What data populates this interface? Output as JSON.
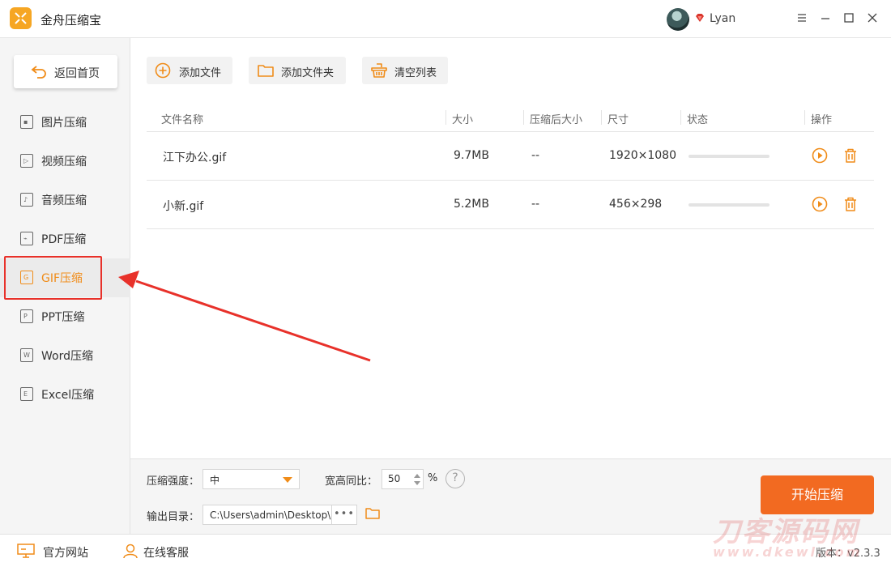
{
  "window": {
    "title": "金舟压缩宝",
    "user": "Lyan",
    "controls": [
      "menu-icon",
      "minimize-icon",
      "maximize-icon",
      "close-icon"
    ]
  },
  "sidebar": {
    "home_label": "返回首页",
    "items": [
      {
        "label": "图片压缩",
        "icon": "image-icon",
        "glyph": "▪"
      },
      {
        "label": "视频压缩",
        "icon": "video-icon",
        "glyph": "▷"
      },
      {
        "label": "音频压缩",
        "icon": "audio-icon",
        "glyph": "♪"
      },
      {
        "label": "PDF压缩",
        "icon": "pdf-icon",
        "glyph": "⌁"
      },
      {
        "label": "GIF压缩",
        "icon": "gif-icon",
        "glyph": "G",
        "active": true
      },
      {
        "label": "PPT压缩",
        "icon": "ppt-icon",
        "glyph": "P"
      },
      {
        "label": "Word压缩",
        "icon": "word-icon",
        "glyph": "W"
      },
      {
        "label": "Excel压缩",
        "icon": "excel-icon",
        "glyph": "E"
      }
    ]
  },
  "toolbar": {
    "add_file": "添加文件",
    "add_folder": "添加文件夹",
    "clear_list": "清空列表"
  },
  "table": {
    "columns": [
      "文件名称",
      "大小",
      "压缩后大小",
      "尺寸",
      "状态",
      "操作"
    ],
    "rows": [
      {
        "name": "江下办公.gif",
        "size": "9.7MB",
        "compressed": "--",
        "dimensions": "1920×1080",
        "progress": 0
      },
      {
        "name": "小新.gif",
        "size": "5.2MB",
        "compressed": "--",
        "dimensions": "456×298",
        "progress": 0
      }
    ]
  },
  "settings": {
    "strength_label": "压缩强度：",
    "strength_value": "中",
    "ratio_label": "宽高同比：",
    "ratio_value": "50",
    "ratio_unit": "%",
    "help": "?",
    "output_label": "输出目录：",
    "output_path": "C:\\Users\\admin\\Desktop\\",
    "browse": "•••",
    "start": "开始压缩"
  },
  "footer": {
    "website": "官方网站",
    "support": "在线客服",
    "version": "版本：v2.3.3"
  },
  "watermark": {
    "line1": "刀客源码网",
    "line2": "www.dkewl.com"
  },
  "colors": {
    "accent": "#f08c19",
    "start_button": "#f26a21",
    "highlight": "#e8312a",
    "logo": "#f6a623"
  }
}
